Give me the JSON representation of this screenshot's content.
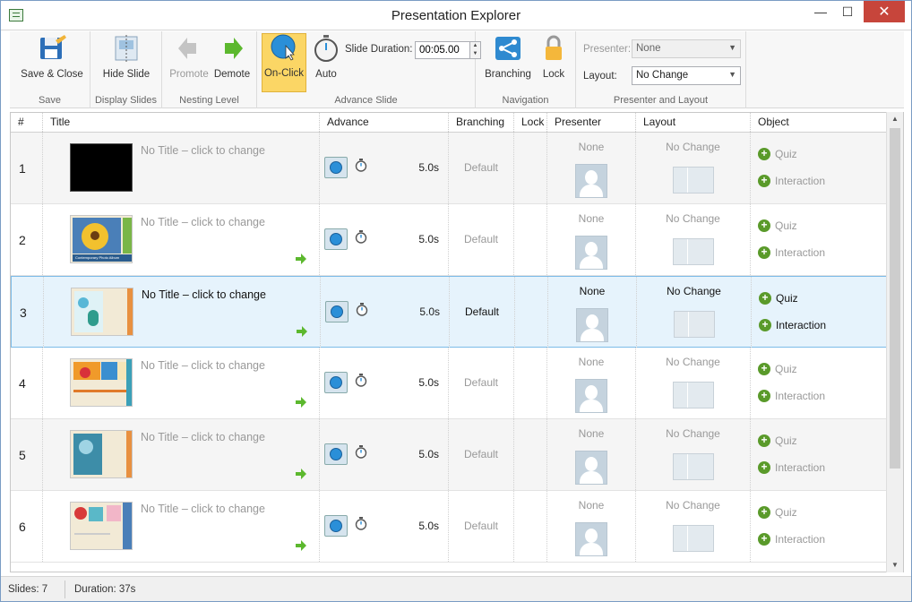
{
  "window": {
    "title": "Presentation Explorer",
    "min": "—",
    "max": "☐",
    "close": "✕"
  },
  "ribbon": {
    "save_close": "Save & Close",
    "group_save": "Save",
    "hide_slide": "Hide Slide",
    "group_display": "Display Slides",
    "promote": "Promote",
    "demote": "Demote",
    "group_nesting": "Nesting Level",
    "on_click": "On-Click",
    "auto": "Auto",
    "slide_duration_label": "Slide Duration:",
    "slide_duration_value": "00:05.00",
    "group_advance": "Advance Slide",
    "branching": "Branching",
    "lock": "Lock",
    "group_navigation": "Navigation",
    "presenter_label": "Presenter:",
    "presenter_value": "None",
    "layout_label": "Layout:",
    "layout_value": "No Change",
    "group_presenter": "Presenter and Layout"
  },
  "table": {
    "headers": [
      "#",
      "Title",
      "Advance",
      "Branching",
      "Lock",
      "Presenter",
      "Layout",
      "Object"
    ],
    "rows": [
      {
        "num": "1",
        "title": "No Title – click to change",
        "duration": "5.0s",
        "branching": "Default",
        "presenter": "None",
        "layout": "No Change",
        "quiz": "Quiz",
        "interaction": "Interaction"
      },
      {
        "num": "2",
        "title": "No Title – click to change",
        "duration": "5.0s",
        "branching": "Default",
        "presenter": "None",
        "layout": "No Change",
        "quiz": "Quiz",
        "interaction": "Interaction",
        "thumb_caption": "Contemporary Photo Album"
      },
      {
        "num": "3",
        "title": "No Title – click to change",
        "duration": "5.0s",
        "branching": "Default",
        "presenter": "None",
        "layout": "No Change",
        "quiz": "Quiz",
        "interaction": "Interaction"
      },
      {
        "num": "4",
        "title": "No Title – click to change",
        "duration": "5.0s",
        "branching": "Default",
        "presenter": "None",
        "layout": "No Change",
        "quiz": "Quiz",
        "interaction": "Interaction"
      },
      {
        "num": "5",
        "title": "No Title – click to change",
        "duration": "5.0s",
        "branching": "Default",
        "presenter": "None",
        "layout": "No Change",
        "quiz": "Quiz",
        "interaction": "Interaction"
      },
      {
        "num": "6",
        "title": "No Title – click to change",
        "duration": "5.0s",
        "branching": "Default",
        "presenter": "None",
        "layout": "No Change",
        "quiz": "Quiz",
        "interaction": "Interaction"
      }
    ],
    "selected_row": "3"
  },
  "status": {
    "slides": "Slides: 7",
    "duration": "Duration: 37s"
  },
  "colors": {
    "accent_active": "#fbd665",
    "selection": "#e6f3fc",
    "plus_green": "#5a9a2a",
    "arrow_green": "#5cb82e"
  }
}
